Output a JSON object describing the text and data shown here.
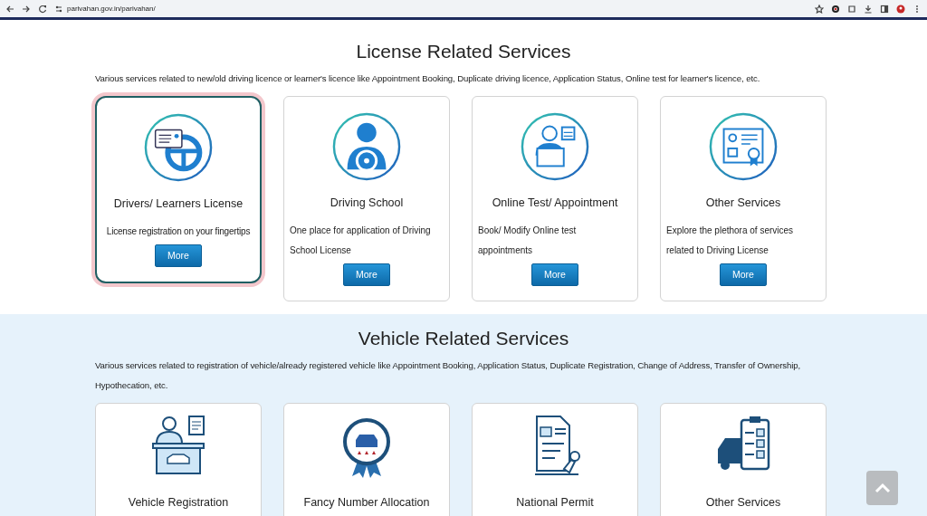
{
  "browser": {
    "url": "parivahan.gov.in/parivahan/"
  },
  "sections": [
    {
      "title": "License Related Services",
      "tinted": false,
      "description": "Various services related to new/old driving licence or learner's licence like Appointment Booking, Duplicate driving licence, Application Status, Online test for learner's licence, etc.",
      "cards": [
        {
          "title": "Drivers/ Learners License",
          "description": "License registration on your fingertips",
          "button": "More",
          "highlighted": true
        },
        {
          "title": "Driving School",
          "description": "One place for application of Driving School License",
          "button": "More",
          "highlighted": false
        },
        {
          "title": "Online Test/ Appointment",
          "description": "Book/ Modify Online test appointments",
          "button": "More",
          "highlighted": false
        },
        {
          "title": "Other Services",
          "description": "Explore the plethora of services related to Driving License",
          "button": "More",
          "highlighted": false
        }
      ]
    },
    {
      "title": "Vehicle Related Services",
      "tinted": true,
      "description": "Various services related to registration of vehicle/already registered vehicle like Appointment Booking, Application Status, Duplicate Registration, Change of Address, Transfer of Ownership, Hypothecation, etc.",
      "cards": [
        {
          "title": "Vehicle Registration",
          "highlighted": false
        },
        {
          "title": "Fancy Number Allocation",
          "highlighted": false
        },
        {
          "title": "National Permit",
          "highlighted": false
        },
        {
          "title": "Other Services",
          "highlighted": false
        }
      ]
    }
  ]
}
